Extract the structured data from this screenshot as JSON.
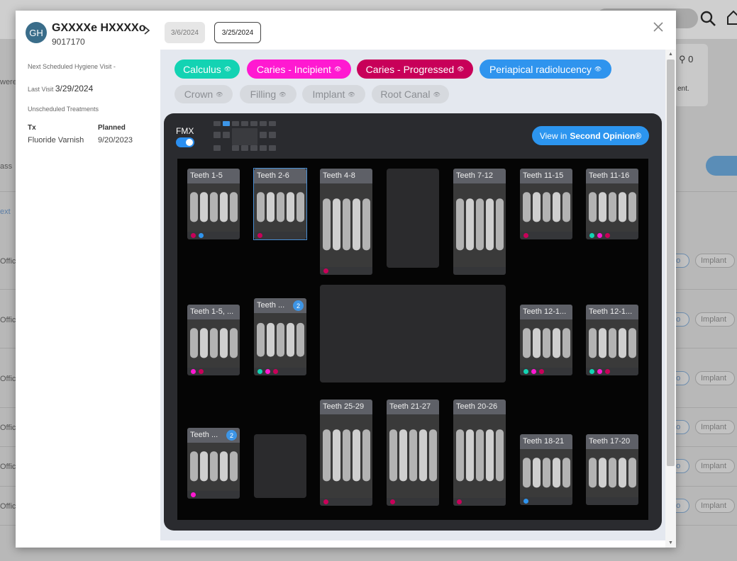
{
  "background": {
    "row_labels": [
      "were",
      "ass",
      "ext",
      "Office",
      "Office",
      "Office",
      "Office",
      "Office",
      "Office"
    ],
    "card": {
      "count": "0",
      "trail_text": "ent."
    },
    "tags": {
      "endo": "do",
      "implant": "Implant"
    }
  },
  "modal": {
    "patient": {
      "initials": "GH",
      "name": "GXXXXe HXXXXo",
      "id": "9017170"
    },
    "date_tabs": [
      "3/6/2024",
      "3/25/2024"
    ],
    "sidebar": {
      "next_hygiene_label": "Next Scheduled Hygiene Visit",
      "next_hygiene_value": "-",
      "last_visit_label": "Last Visit",
      "last_visit_value": "3/29/2024",
      "unscheduled_label": "Unscheduled Treatments",
      "tx_header": "Tx",
      "planned_header": "Planned",
      "treatments": [
        {
          "tx": "Fluoride Varnish",
          "planned": "9/20/2023"
        }
      ]
    },
    "filters": {
      "active": [
        {
          "label": "Calculus",
          "color": "#13d3b3"
        },
        {
          "label": "Caries - Incipient",
          "color": "#ff19d1"
        },
        {
          "label": "Caries - Progressed",
          "color": "#c80059"
        },
        {
          "label": "Periapical radiolucency",
          "color": "#2f94ee"
        }
      ],
      "inactive": [
        {
          "label": "Crown"
        },
        {
          "label": "Filling"
        },
        {
          "label": "Implant"
        },
        {
          "label": "Root Canal"
        }
      ]
    },
    "viewer": {
      "fmx_label": "FMX",
      "fmx_on": true,
      "second_opinion_prefix": "View in",
      "second_opinion_brand": "Second Opinion®",
      "tiles": [
        {
          "label": "Teeth 1-5",
          "dots": [
            "#c80059",
            "#2f94ee"
          ]
        },
        {
          "label": "Teeth 2-6",
          "dots": [
            "#c80059"
          ],
          "selected": true
        },
        {
          "label": "Teeth 4-8",
          "dots": [
            "#c80059"
          ]
        },
        {
          "label": "Teeth 7-12",
          "dots": []
        },
        {
          "label": "Teeth 11-15",
          "dots": [
            "#c80059"
          ]
        },
        {
          "label": "Teeth 11-16",
          "dots": [
            "#13d3b3",
            "#ff19d1",
            "#c80059"
          ]
        },
        {
          "label": "Teeth 1-5, ...",
          "dots": [
            "#ff19d1",
            "#c80059"
          ]
        },
        {
          "label": "Teeth ...",
          "badge": "2",
          "dots": [
            "#13d3b3",
            "#ff19d1",
            "#c80059"
          ]
        },
        {
          "label": "Teeth 12-1...",
          "dots": [
            "#13d3b3",
            "#ff19d1",
            "#c80059"
          ]
        },
        {
          "label": "Teeth 12-1...",
          "dots": [
            "#13d3b3",
            "#ff19d1",
            "#c80059"
          ]
        },
        {
          "label": "Teeth 25-29",
          "dots": [
            "#c80059"
          ]
        },
        {
          "label": "Teeth 21-27",
          "dots": [
            "#c80059"
          ]
        },
        {
          "label": "Teeth 20-26",
          "dots": [
            "#c80059"
          ]
        },
        {
          "label": "Teeth ...",
          "badge": "2",
          "dots": [
            "#ff19d1"
          ]
        },
        {
          "label": "Teeth 18-21",
          "dots": [
            "#2f94ee"
          ]
        },
        {
          "label": "Teeth 17-20",
          "dots": []
        }
      ]
    }
  }
}
